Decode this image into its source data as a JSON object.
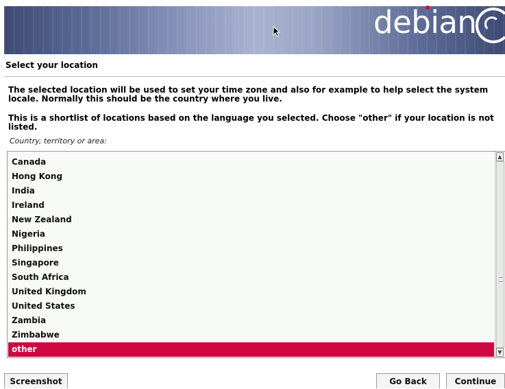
{
  "header": {
    "logo_text": "debian",
    "accent_color": "#d70751"
  },
  "page": {
    "title": "Select your location",
    "description_1": "The selected location will be used to set your time zone and also for example to help select the system locale. Normally this should be the country where you live.",
    "description_2": "This is a shortlist of locations based on the language you selected. Choose \"other\" if your location is not listed.",
    "prompt": "Country, territory or area:"
  },
  "locations": {
    "items": [
      "Canada",
      "Hong Kong",
      "India",
      "Ireland",
      "New Zealand",
      "Nigeria",
      "Philippines",
      "Singapore",
      "South Africa",
      "United Kingdom",
      "United States",
      "Zambia",
      "Zimbabwe",
      "other"
    ],
    "selected": "other",
    "selection_color": "#d0073f"
  },
  "buttons": {
    "screenshot": "Screenshot",
    "go_back": "Go Back",
    "continue": "Continue"
  },
  "icons": {
    "cursor": "mouse-pointer-icon",
    "scroll_up": "arrow-up-icon",
    "scroll_down": "arrow-down-icon",
    "logo_swirl": "debian-swirl-icon"
  }
}
